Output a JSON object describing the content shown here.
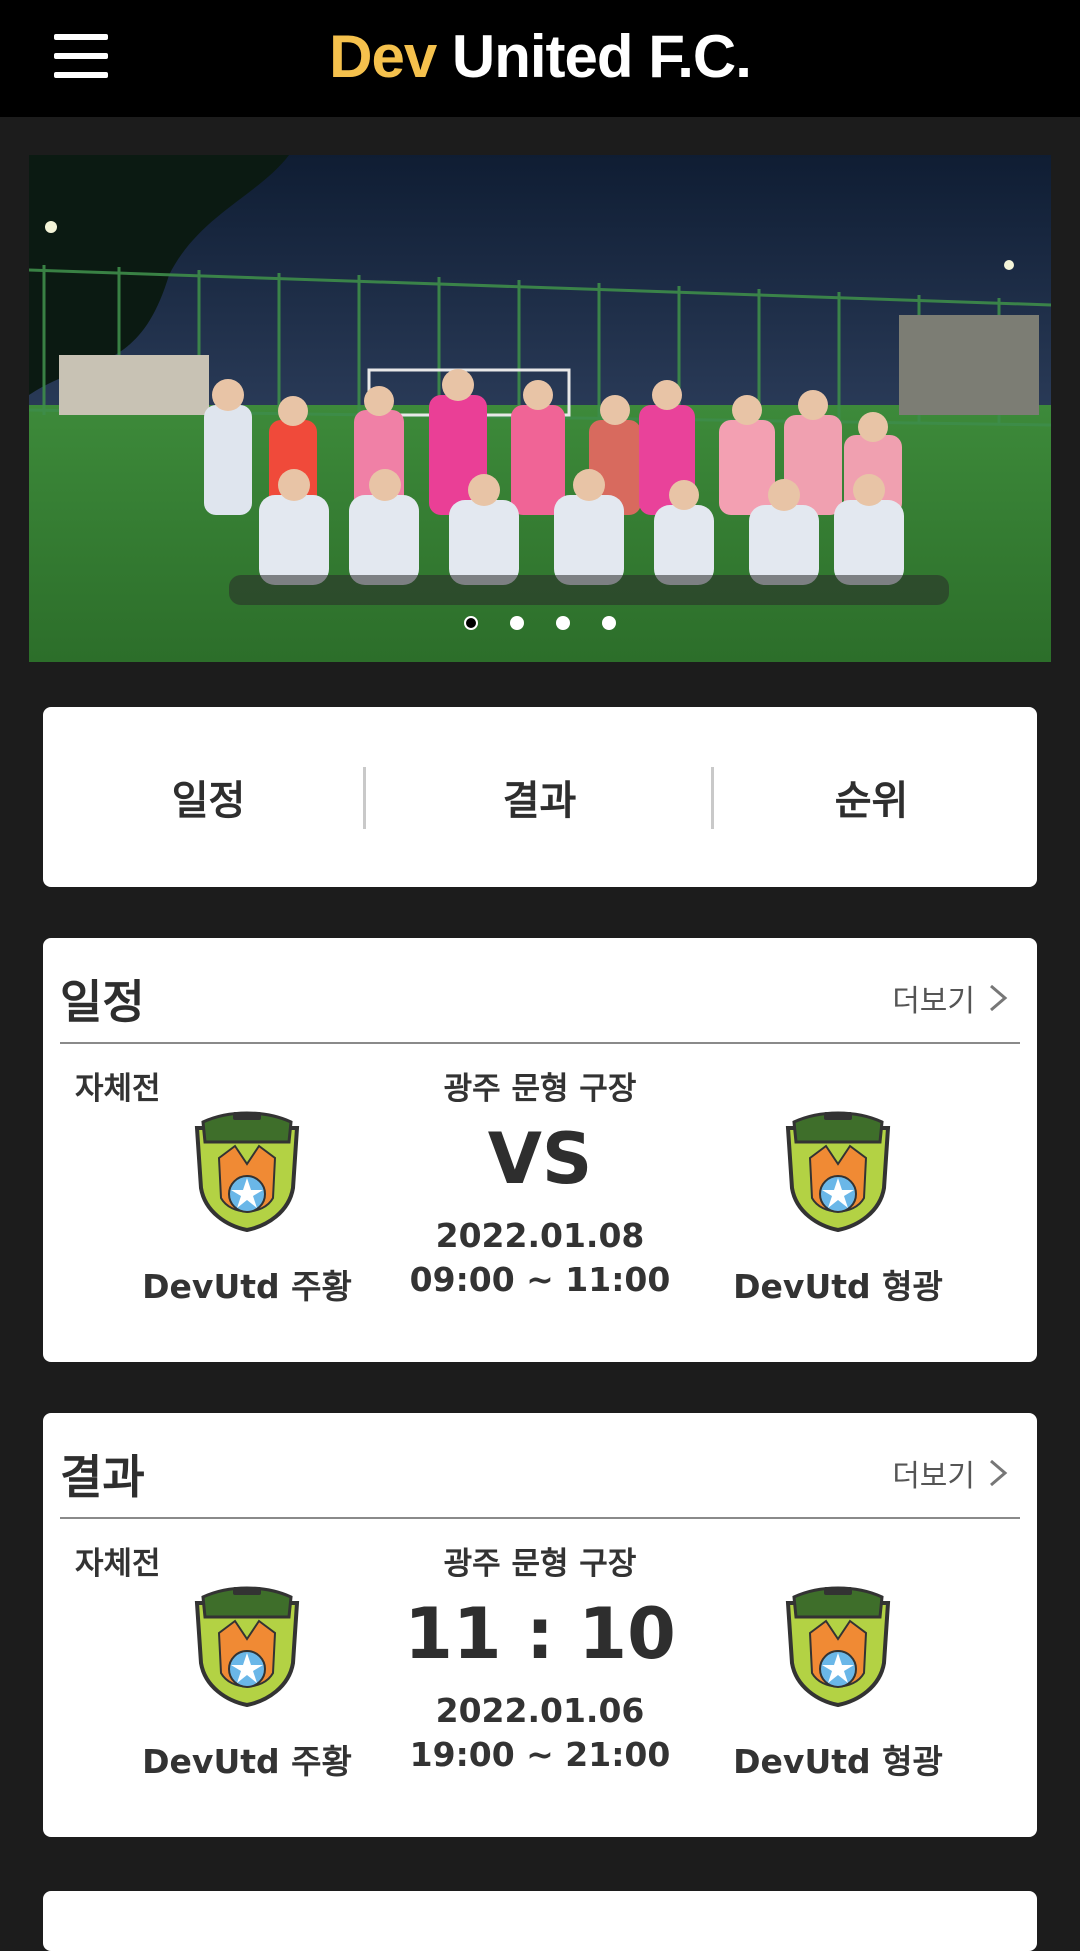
{
  "header": {
    "brand_accent": "Dev",
    "brand_rest": " United F.C.",
    "menu_icon": "hamburger-menu-icon",
    "accent_color": "#f5c14d"
  },
  "carousel": {
    "slide_count": 4,
    "active_index": 0
  },
  "tabs": [
    {
      "label": "일정"
    },
    {
      "label": "결과"
    },
    {
      "label": "순위"
    }
  ],
  "schedule": {
    "title": "일정",
    "more_label": "더보기",
    "match_type": "자체전",
    "venue": "광주 문형 구장",
    "center_text": "VS",
    "date": "2022.01.08",
    "time": "09:00 ~ 11:00",
    "home_team": "DevUtd 주황",
    "away_team": "DevUtd 형광"
  },
  "results": {
    "title": "결과",
    "more_label": "더보기",
    "match_type": "자체전",
    "venue": "광주 문형 구장",
    "center_text": "11 : 10",
    "date": "2022.01.06",
    "time": "19:00 ~ 21:00",
    "home_team": "DevUtd 주황",
    "away_team": "DevUtd 형광"
  }
}
